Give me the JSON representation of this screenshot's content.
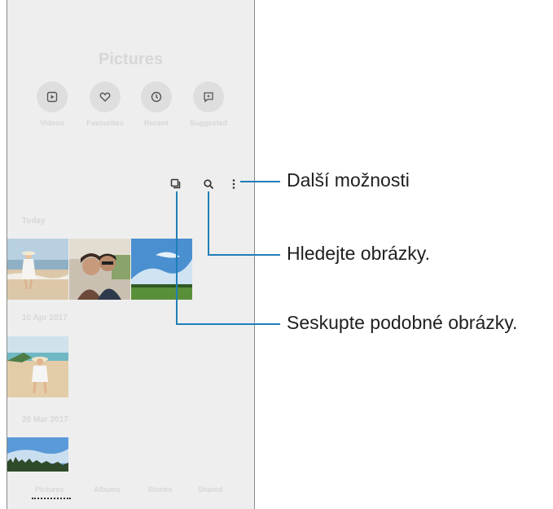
{
  "app": {
    "title": "Pictures",
    "quick_actions": [
      {
        "label": "Videos",
        "icon": "play-icon"
      },
      {
        "label": "Favourites",
        "icon": "heart-icon"
      },
      {
        "label": "Recent",
        "icon": "clock-icon"
      },
      {
        "label": "Suggested",
        "icon": "chat-sparkle-icon"
      }
    ],
    "toolbar_icons": [
      "group-similar-icon",
      "search-icon",
      "more-options-icon"
    ],
    "sections": [
      {
        "date": "Today"
      },
      {
        "date": "10 Apr 2017"
      },
      {
        "date": "20 Mar 2017"
      }
    ],
    "bottom_tabs": [
      "Pictures",
      "Albums",
      "Stories",
      "Shared"
    ]
  },
  "callouts": {
    "more_options": "Další možnosti",
    "search": "Hledejte obrázky.",
    "group_similar": "Seskupte podobné obrázky."
  },
  "colors": {
    "accent_line": "#1f7fb8"
  }
}
